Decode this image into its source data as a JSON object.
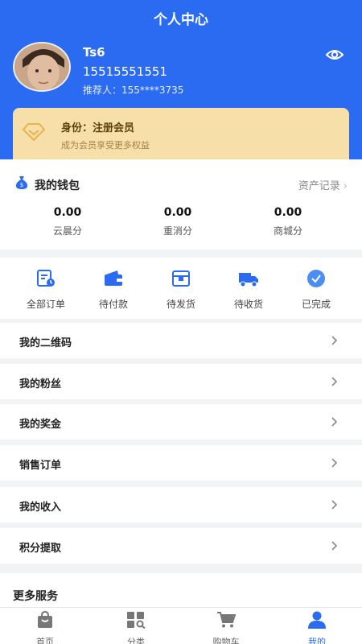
{
  "header": {
    "title": "个人中心",
    "user": {
      "name": "Ts6",
      "phone": "15515551551",
      "referrer": "推荐人：155****3735"
    }
  },
  "membership": {
    "title": "身份：注册会员",
    "subtitle": "成为会员享受更多权益"
  },
  "wallet": {
    "title": "我的钱包",
    "link": "资产记录",
    "stats": [
      {
        "value": "0.00",
        "label": "云晨分"
      },
      {
        "value": "0.00",
        "label": "重消分"
      },
      {
        "value": "0.00",
        "label": "商城分"
      }
    ]
  },
  "orders": [
    {
      "label": "全部订单",
      "icon": "order-list-icon"
    },
    {
      "label": "待付款",
      "icon": "wallet-icon"
    },
    {
      "label": "待发货",
      "icon": "package-icon"
    },
    {
      "label": "待收货",
      "icon": "truck-icon"
    },
    {
      "label": "已完成",
      "icon": "check-circle-icon"
    }
  ],
  "menu": [
    "我的二维码",
    "我的粉丝",
    "我的奖金",
    "销售订单",
    "我的收入",
    "积分提取"
  ],
  "more_services": "更多服务",
  "tabbar": [
    {
      "label": "首页",
      "icon": "home-bag-icon"
    },
    {
      "label": "分类",
      "icon": "category-grid-icon"
    },
    {
      "label": "购物车",
      "icon": "cart-icon"
    },
    {
      "label": "我的",
      "icon": "user-icon",
      "active": true
    }
  ],
  "colors": {
    "primary": "#2a6bf2",
    "member_bg": "#f6dfa9",
    "member_text": "#5d3f0d",
    "page_bg": "#f2f3f5"
  }
}
